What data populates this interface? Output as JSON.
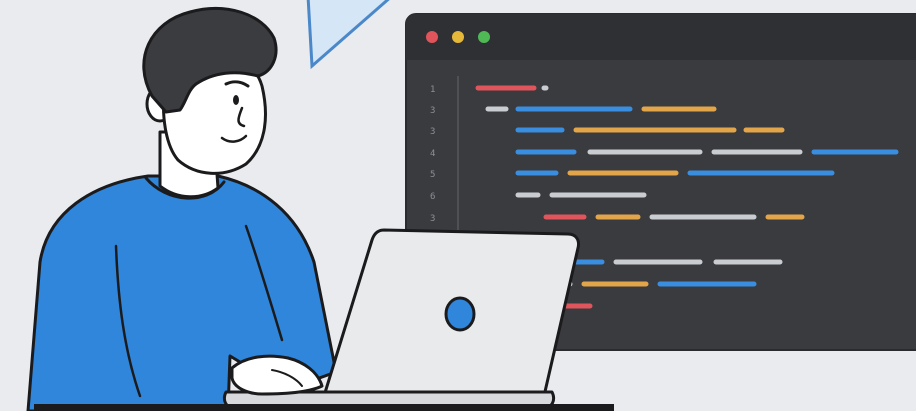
{
  "editor": {
    "window_dots": [
      "#e0555b",
      "#e6b83a",
      "#4fb956"
    ],
    "line_numbers": [
      "1",
      "3",
      "3",
      "4",
      "5",
      "6",
      "3"
    ]
  },
  "colors": {
    "background": "#e9ebee",
    "editor_bg": "#3a3b3f",
    "editor_bar": "#2f3033",
    "shirt": "#2f86db",
    "laptop": "#e9eaec",
    "laptop_logo": "#2f86db",
    "code_red": "#e0555b",
    "code_blue": "#3a8ee0",
    "code_orange": "#e2a54a",
    "code_gray": "#c9ccd1"
  },
  "icons": [
    "speech-triangle-icon",
    "laptop-logo-icon"
  ]
}
